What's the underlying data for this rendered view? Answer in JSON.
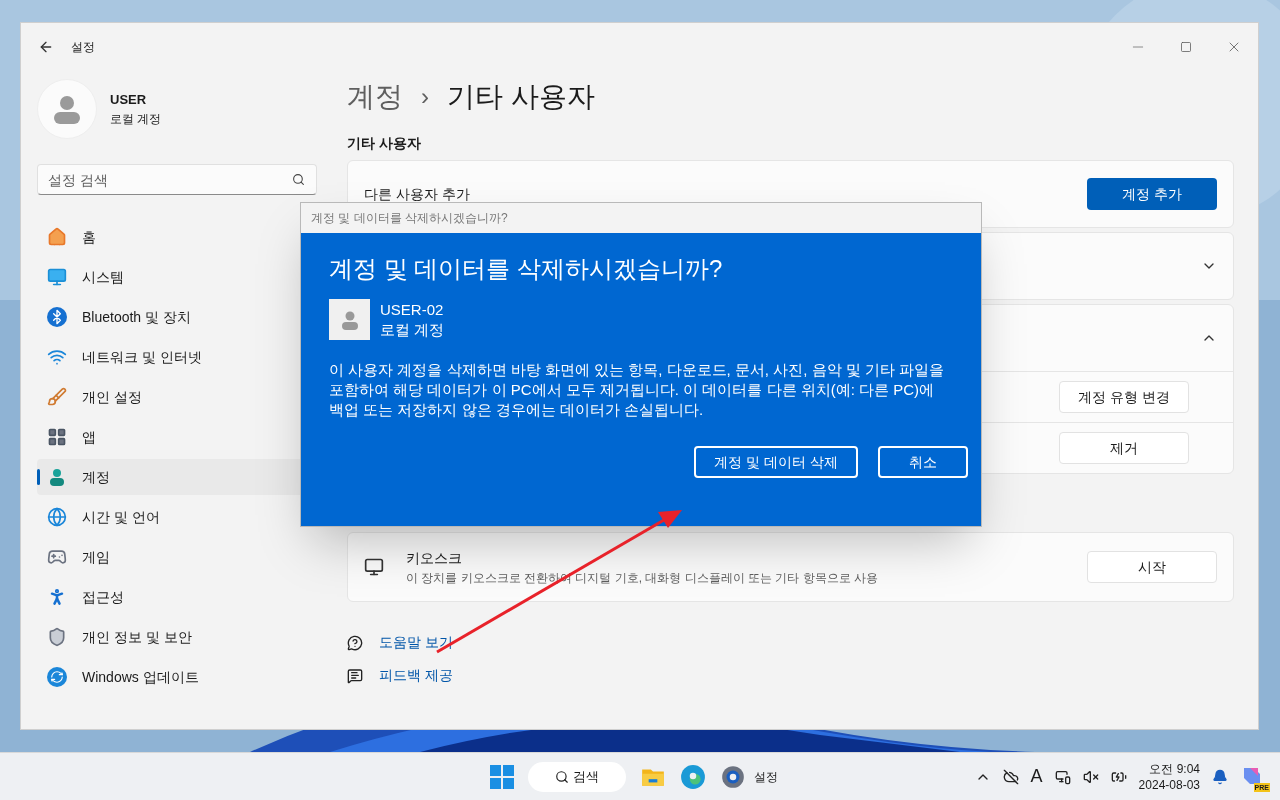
{
  "window": {
    "title": "설정"
  },
  "profile": {
    "name": "USER",
    "type": "로컬 계정"
  },
  "search": {
    "placeholder": "설정 검색"
  },
  "nav": [
    {
      "label": "홈",
      "selected": false
    },
    {
      "label": "시스템",
      "selected": false
    },
    {
      "label": "Bluetooth 및 장치",
      "selected": false
    },
    {
      "label": "네트워크 및 인터넷",
      "selected": false
    },
    {
      "label": "개인 설정",
      "selected": false
    },
    {
      "label": "앱",
      "selected": false
    },
    {
      "label": "계정",
      "selected": true
    },
    {
      "label": "시간 및 언어",
      "selected": false
    },
    {
      "label": "게임",
      "selected": false
    },
    {
      "label": "접근성",
      "selected": false
    },
    {
      "label": "개인 정보 및 보안",
      "selected": false
    },
    {
      "label": "Windows 업데이트",
      "selected": false
    }
  ],
  "breadcrumb": {
    "parent": "계정",
    "separator": "›",
    "current": "기타 사용자"
  },
  "section_title": "기타 사용자",
  "add_user": {
    "label": "다른 사용자 추가",
    "button": "계정 추가"
  },
  "accounts": [
    {
      "expanded": false
    },
    {
      "expanded": true,
      "actions": [
        "계정 유형 변경",
        "제거"
      ]
    }
  ],
  "kiosk": {
    "title": "키오스크",
    "description": "이 장치를 키오스크로 전환하여 디지털 기호, 대화형 디스플레이 또는 기타 항목으로 사용",
    "button": "시작"
  },
  "links": [
    "도움말 보기",
    "피드백 제공"
  ],
  "dialog": {
    "caption": "계정 및 데이터를 삭제하시겠습니까?",
    "heading": "계정 및 데이터를 삭제하시겠습니까?",
    "user": {
      "name": "USER-02",
      "type": "로컬 계정"
    },
    "message": "이 사용자 계정을 삭제하면 바탕 화면에 있는 항목, 다운로드, 문서, 사진, 음악 및 기타 파일을 포함하여 해당 데이터가 이 PC에서 모두 제거됩니다. 이 데이터를 다른 위치(예: 다른 PC)에 백업 또는 저장하지 않은 경우에는 데이터가 손실됩니다.",
    "buttons": [
      "계정 및 데이터 삭제",
      "취소"
    ]
  },
  "taskbar": {
    "search": "검색",
    "running_app": "설정",
    "input_indicator": "A",
    "time": "오전 9:04",
    "date": "2024-08-03",
    "copilot_badge": "PRE"
  }
}
